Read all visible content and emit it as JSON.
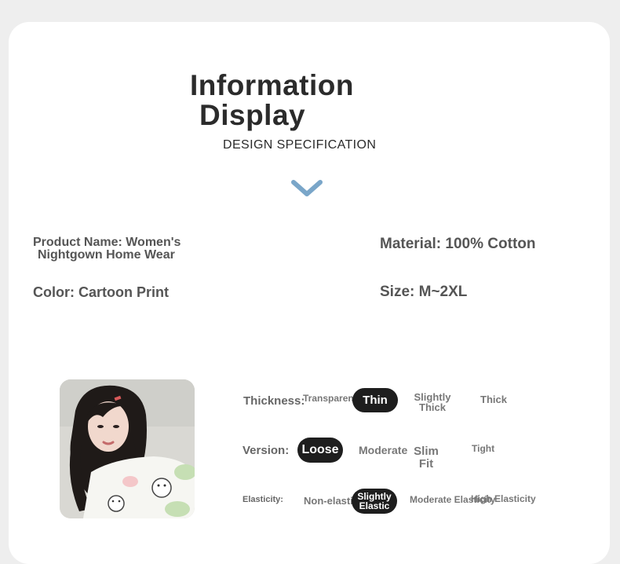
{
  "header": {
    "title_line1": "Information",
    "title_line2": "Display",
    "subtitle": "DESIGN SPECIFICATION"
  },
  "specs": {
    "product_name": "Product Name: Women's",
    "product_name_cont": "Nightgown Home Wear",
    "material": "Material: 100% Cotton",
    "color": "Color: Cartoon Print",
    "size": "Size: M~2XL"
  },
  "attributes": {
    "thickness": {
      "label": "Thickness:",
      "options": [
        "Transparent",
        "Thin",
        "Slightly Thick",
        "Thick"
      ],
      "selected": "Thin"
    },
    "version": {
      "label": "Version:",
      "options": [
        "Loose",
        "Moderate",
        "Slim Fit",
        "Tight"
      ],
      "selected": "Loose"
    },
    "elasticity": {
      "label": "Elasticity:",
      "options": [
        "Non-elastic",
        "Slightly Elastic",
        "Moderate Elasticity",
        "High Elasticity"
      ],
      "selected": "Slightly Elastic"
    }
  },
  "colors": {
    "accent_chevron": "#7aa6c9",
    "pill_bg": "#1e1e1e",
    "text_dark": "#2b2b2b",
    "text_gray": "#555555"
  }
}
